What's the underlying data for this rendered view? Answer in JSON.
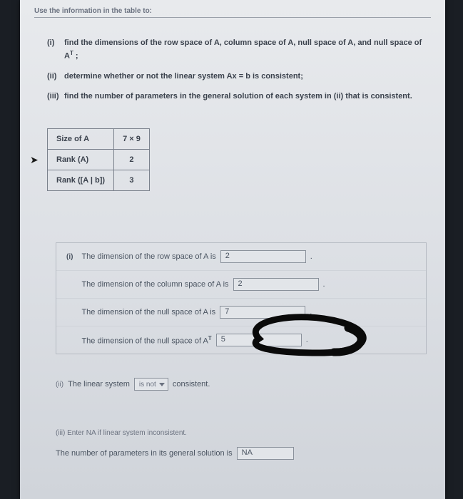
{
  "header": {
    "instruction": "Use the information in the table to:"
  },
  "questions": {
    "i_label": "(i)",
    "i_text": "find the dimensions of the row space of A, column space of A, null space of A, and null space of A",
    "i_sup": "T",
    "i_end": " ;",
    "ii_label": "(ii)",
    "ii_text": "determine whether or not the linear system Ax = b is consistent;",
    "iii_label": "(iii)",
    "iii_text": "find the number of parameters in the general solution of each system in (ii) that is consistent."
  },
  "table": {
    "rows": [
      {
        "label": "Size of A",
        "value": "7 × 9"
      },
      {
        "label": "Rank (A)",
        "value": "2"
      },
      {
        "label": "Rank ([A | b])",
        "value": "3"
      }
    ]
  },
  "answers": {
    "i_label": "(i)",
    "row_space": {
      "text": "The dimension of the row space of A is",
      "value": "2"
    },
    "col_space": {
      "text": "The dimension of the column space of A is",
      "value": "2"
    },
    "null_space": {
      "text": "The dimension of the null space of A is",
      "value": "7"
    },
    "null_space_t": {
      "text_a": "The dimension of the null space of A",
      "sup": "T",
      "value": "5"
    }
  },
  "section2": {
    "label": "(ii)",
    "text_a": "The linear system",
    "dropdown": "is not",
    "text_b": "consistent."
  },
  "section3": {
    "label": "(iii)",
    "hint": "Enter NA if linear system inconsistent.",
    "text": "The number of parameters in its general solution is",
    "value": "NA"
  }
}
